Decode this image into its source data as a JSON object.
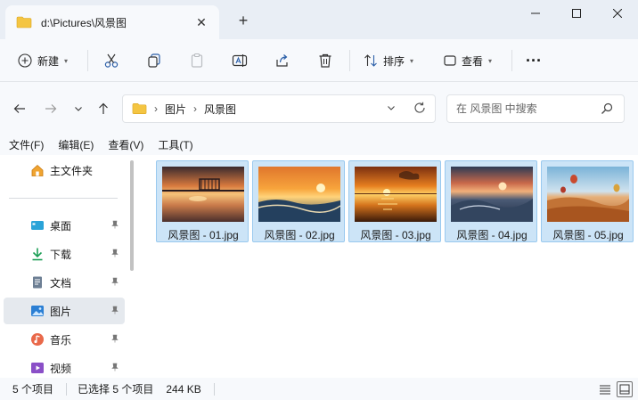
{
  "window": {
    "tab_title": "d:\\Pictures\\风景图",
    "tab_close": "✕",
    "new_tab": "+"
  },
  "toolbar": {
    "new_label": "新建",
    "sort_label": "排序",
    "view_label": "查看",
    "more_label": "···"
  },
  "address": {
    "crumbs": [
      "图片",
      "风景图"
    ],
    "separator": "›"
  },
  "search": {
    "placeholder": "在 风景图 中搜索"
  },
  "menu": [
    "文件(F)",
    "编辑(E)",
    "查看(V)",
    "工具(T)"
  ],
  "sidebar": {
    "items": [
      {
        "label": "主文件夹",
        "icon": "home-icon",
        "pinned": false
      },
      {
        "label": "桌面",
        "icon": "desktop-icon",
        "pinned": true
      },
      {
        "label": "下载",
        "icon": "download-icon",
        "pinned": true
      },
      {
        "label": "文档",
        "icon": "document-icon",
        "pinned": true
      },
      {
        "label": "图片",
        "icon": "pictures-icon",
        "pinned": true,
        "selected": true
      },
      {
        "label": "音乐",
        "icon": "music-icon",
        "pinned": true
      },
      {
        "label": "视频",
        "icon": "video-icon",
        "pinned": true
      }
    ],
    "pin_glyph": "📌"
  },
  "files": [
    {
      "name": "风景图 - 01.jpg",
      "selected": true
    },
    {
      "name": "风景图 - 02.jpg",
      "selected": true
    },
    {
      "name": "风景图 - 03.jpg",
      "selected": true
    },
    {
      "name": "风景图 - 04.jpg",
      "selected": true
    },
    {
      "name": "风景图 - 05.jpg",
      "selected": true
    }
  ],
  "status": {
    "item_count": "5 个项目",
    "selected_info": "已选择 5 个项目",
    "size": "244 KB"
  },
  "colors": {
    "selection_bg": "#cce4f7",
    "selection_border": "#99c9ef",
    "folder_yellow": "#f4c542",
    "accent": "#0067c0"
  }
}
